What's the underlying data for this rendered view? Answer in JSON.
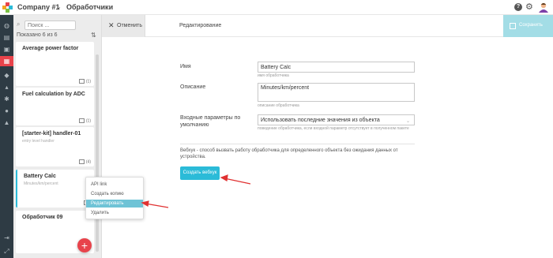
{
  "topbar": {
    "company": "Company #1",
    "page_title": "Обработчики",
    "help_glyph": "?"
  },
  "icons": {
    "logo": "logo-icon",
    "chevron": "chevron-down-icon",
    "help": "help-icon",
    "settings": "gear-icon",
    "avatar": "avatar-icon"
  },
  "colors": {
    "nav_bg": "#2e3b44",
    "accent_red": "#e8434b",
    "accent_teal": "#2bbbd8",
    "save_disabled": "#a3dde6",
    "menu_selected": "#6fc3d6"
  },
  "list": {
    "search_placeholder": "Поиск ...",
    "shown_text": "Показано 6 из 6",
    "items": [
      {
        "title": "Average power factor",
        "subtitle": "",
        "count": "(1)"
      },
      {
        "title": "Fuel calculation by ADC",
        "subtitle": "",
        "count": "(1)"
      },
      {
        "title": "[starter-kit] handler-01",
        "subtitle": "entry level handler",
        "count": "(4)"
      },
      {
        "title": "Battery Calc",
        "subtitle": "Minutes/km/percent",
        "count": ""
      },
      {
        "title": "Обработчик 09",
        "subtitle": "",
        "count": ""
      }
    ],
    "add_label": "+"
  },
  "context_menu": {
    "items": [
      "API link",
      "Создать копию",
      "Редактировать",
      "Удалить"
    ],
    "selected_index": 2
  },
  "editor": {
    "cancel_label": "Отменить",
    "title": "Редактирование",
    "save_label": "Сохранить"
  },
  "form": {
    "name_label": "Имя",
    "name_value": "Battery Calc",
    "name_hint": "имя обработчика",
    "description_label": "Описание",
    "description_value": "Minutes/km/percent",
    "description_hint": "описание обработчика",
    "inputs_label": "Входные параметры по умолчанию",
    "inputs_value": "Использовать последние значения из объекта",
    "inputs_hint": "поведение обработчика, если входной параметр отсутствует в полученном пакете"
  },
  "webhook": {
    "text": "Вебхук - способ вызвать работу обработчика для определенного объекта без ожидания данных от устройства.",
    "button_label": "Создать вебхук"
  }
}
